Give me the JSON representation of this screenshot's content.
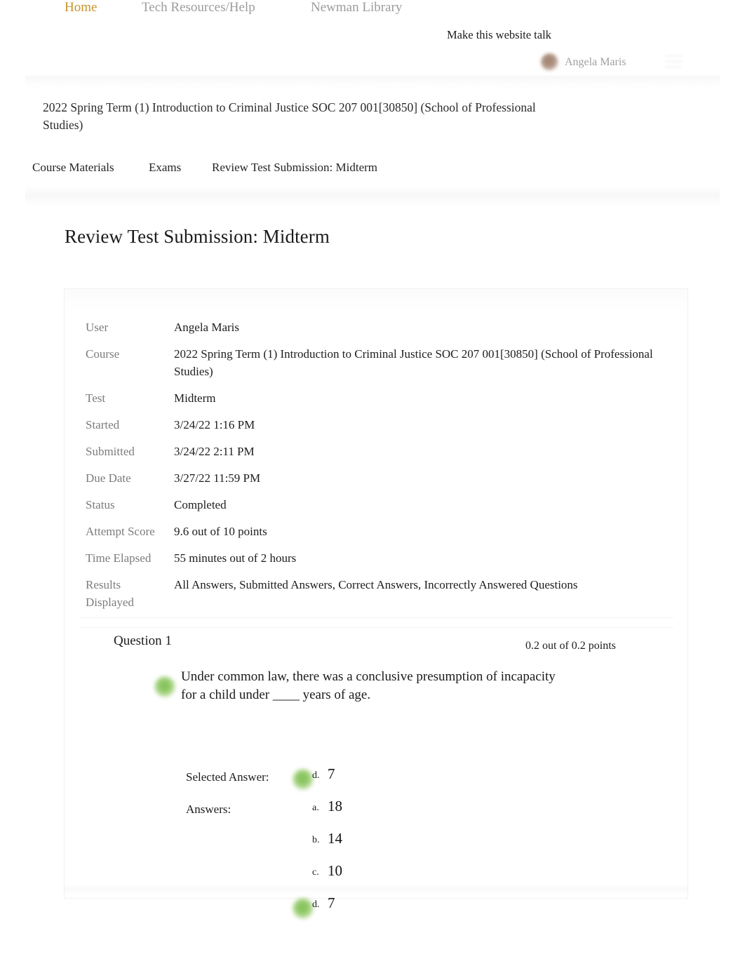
{
  "topbar": {
    "nav": [
      {
        "label": "Home",
        "active": true
      },
      {
        "label": "Tech Resources/Help",
        "active": false
      },
      {
        "label": "Newman Library",
        "active": false
      }
    ],
    "talk_label": "Make this website talk",
    "user_name": "Angela Maris",
    "menu_icon": "hamburger-menu-icon",
    "avatar_icon": "user-avatar"
  },
  "course": {
    "title": "2022 Spring Term (1) Introduction to Criminal Justice SOC 207 001[30850] (School of Professional Studies)"
  },
  "breadcrumbs": [
    {
      "label": "Course Materials"
    },
    {
      "label": "Exams"
    },
    {
      "label": "Review Test Submission: Midterm"
    }
  ],
  "page": {
    "heading": "Review Test Submission: Midterm"
  },
  "info": {
    "rows": [
      {
        "label": "User",
        "value": "Angela Maris"
      },
      {
        "label": "Course",
        "value": "2022 Spring Term (1) Introduction to Criminal Justice SOC 207 001[30850] (School of Professional Studies)"
      },
      {
        "label": "Test",
        "value": "Midterm"
      },
      {
        "label": "Started",
        "value": "3/24/22 1:16 PM"
      },
      {
        "label": "Submitted",
        "value": "3/24/22 2:11 PM"
      },
      {
        "label": "Due Date",
        "value": "3/27/22 11:59 PM"
      },
      {
        "label": "Status",
        "value": "Completed"
      },
      {
        "label": "Attempt Score",
        "value": "9.6 out of 10 points"
      },
      {
        "label": "Time Elapsed",
        "value": "55 minutes out of 2 hours"
      },
      {
        "label": "Results Displayed",
        "value": "All Answers, Submitted Answers, Correct Answers, Incorrectly Answered Questions"
      }
    ]
  },
  "question": {
    "title": "Question 1",
    "points": "0.2 out of 0.2 points",
    "text": "Under common law, there was a conclusive presumption of incapacity for a child under ____ years of age.",
    "correct_icon": "green-check-icon",
    "selected_answer_label": "Selected Answer:",
    "answers_label": "Answers:",
    "selected_answer": {
      "letter": "d.",
      "value": "7",
      "correct": true
    },
    "choices": [
      {
        "letter": "a.",
        "value": "18",
        "correct": false
      },
      {
        "letter": "b.",
        "value": "14",
        "correct": false
      },
      {
        "letter": "c.",
        "value": "10",
        "correct": false
      },
      {
        "letter": "d.",
        "value": "7",
        "correct": true
      }
    ]
  },
  "colors": {
    "accent": "#c8942a",
    "nav_inactive": "#9c9c9c",
    "label_gray": "#7c7c7c",
    "text": "#1b1b1b",
    "correct_green": "#7fbf55"
  }
}
